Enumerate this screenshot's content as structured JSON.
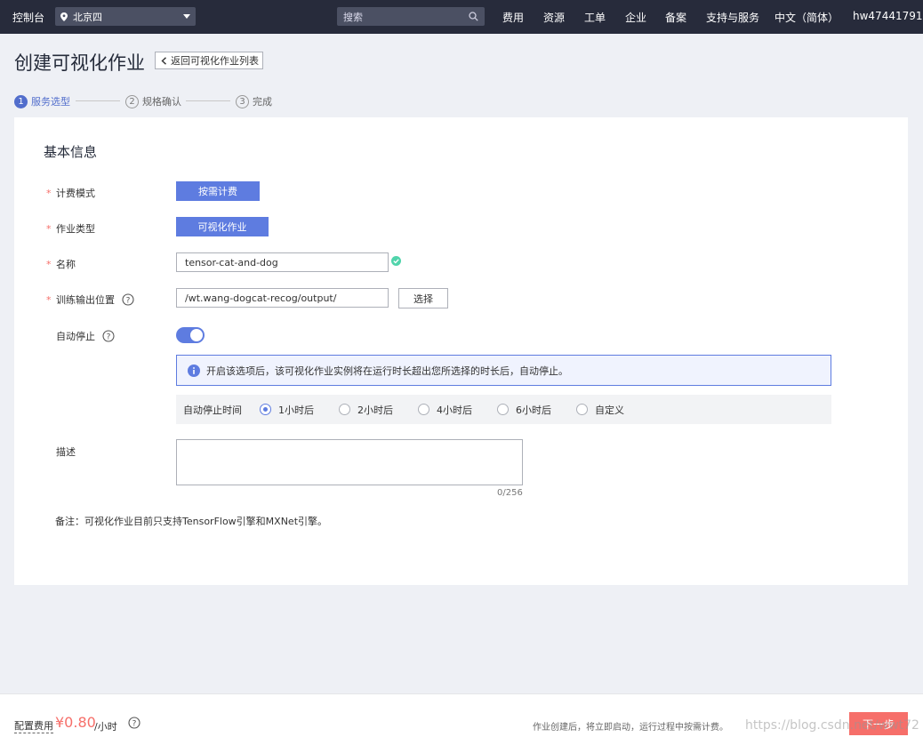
{
  "topbar": {
    "console": "控制台",
    "region": "北京四",
    "search_placeholder": "搜索",
    "nav": [
      "费用",
      "资源",
      "工单",
      "企业",
      "备案",
      "支持与服务",
      "中文（简体）",
      "hw47441791"
    ]
  },
  "header": {
    "title": "创建可视化作业",
    "back_label": "返回可视化作业列表"
  },
  "steps": [
    {
      "num": "1",
      "label": "服务选型"
    },
    {
      "num": "2",
      "label": "规格确认"
    },
    {
      "num": "3",
      "label": "完成"
    }
  ],
  "form": {
    "section_title": "基本信息",
    "billing_label": "计费模式",
    "billing_value": "按需计费",
    "job_type_label": "作业类型",
    "job_type_value": "可视化作业",
    "name_label": "名称",
    "name_value": "tensor-cat-and-dog",
    "output_label": "训练输出位置",
    "output_value": "/wt.wang-dogcat-recog/output/",
    "choose_label": "选择",
    "auto_stop_label": "自动停止",
    "auto_stop_on": true,
    "info_text": "开启该选项后，该可视化作业实例将在运行时长超出您所选择的时长后，自动停止。",
    "stop_time_label": "自动停止时间",
    "stop_options": [
      "1小时后",
      "2小时后",
      "4小时后",
      "6小时后",
      "自定义"
    ],
    "stop_selected": "1小时后",
    "desc_label": "描述",
    "desc_value": "",
    "desc_counter": "0/256",
    "note": "备注：可视化作业目前只支持TensorFlow引擎和MXNet引擎。"
  },
  "footer": {
    "fee_label": "配置费用",
    "fee_value": "¥0.80",
    "fee_unit": "/小时",
    "note": "作业创建后，将立即启动，运行过程中按需计费。",
    "next_label": "下一步",
    "watermark": "https://blog.csdn.net/wwt72"
  },
  "colors": {
    "topbar": "#272b3b",
    "primary": "#5e7ce0",
    "danger": "#f66f6a",
    "success": "#50d4ab"
  }
}
